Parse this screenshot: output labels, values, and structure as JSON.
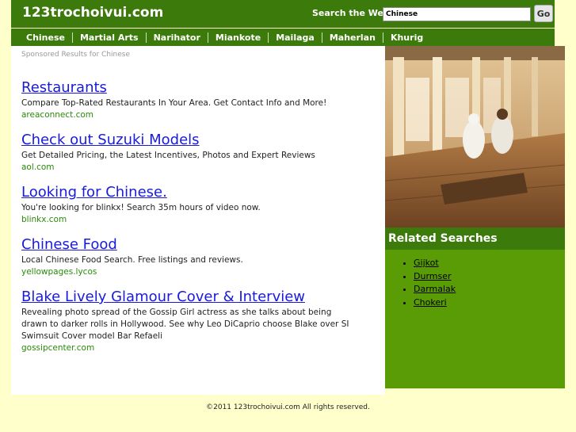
{
  "header": {
    "site_title": "123trochoivui.com",
    "search_label": "Search the Web:",
    "search_value": "Chinese",
    "go_label": "Go"
  },
  "nav": {
    "items": [
      "Chinese",
      "Martial Arts",
      "Narihator",
      "Miankote",
      "Mailaga",
      "Maherlan",
      "Khurig"
    ]
  },
  "content": {
    "sponsored_label": "Sponsored Results for Chinese",
    "results": [
      {
        "title": "Restaurants",
        "desc": "Compare Top-Rated Restaurants In Your Area. Get Contact Info and More!",
        "url": "areaconnect.com"
      },
      {
        "title": "Check out Suzuki Models",
        "desc": "Get Detailed Pricing, the Latest Incentives, Photos and Expert Reviews",
        "url": "aol.com"
      },
      {
        "title": "Looking for Chinese.",
        "desc": "You're looking for blinkx! Search 35m hours of video now.",
        "url": "blinkx.com"
      },
      {
        "title": "Chinese Food",
        "desc": "Local Chinese Food Search. Free listings and reviews.",
        "url": "yellowpages.lycos"
      },
      {
        "title": "Blake Lively Glamour Cover & Interview",
        "desc": "Revealing photo spread of the Gossip Girl actress as she talks about being drawn to darker rolls in Hollywood. See why Leo DiCaprio choose Blake over SI Swimsuit Cover model Bar Refaeli",
        "url": "gossipcenter.com"
      }
    ]
  },
  "sidebar": {
    "related_title": "Related Searches",
    "related": [
      "Gijkot",
      "Durmser",
      "Darmalak",
      "Chokeri"
    ]
  },
  "footer": {
    "text": "©2011 123trochoivui.com All rights reserved."
  },
  "colors": {
    "header_green": "#3d7a0c",
    "sidebar_green": "#5a9c06",
    "page_bg": "#ffffcc",
    "link_blue": "#1a1adb",
    "url_green": "#2a8a0a"
  }
}
